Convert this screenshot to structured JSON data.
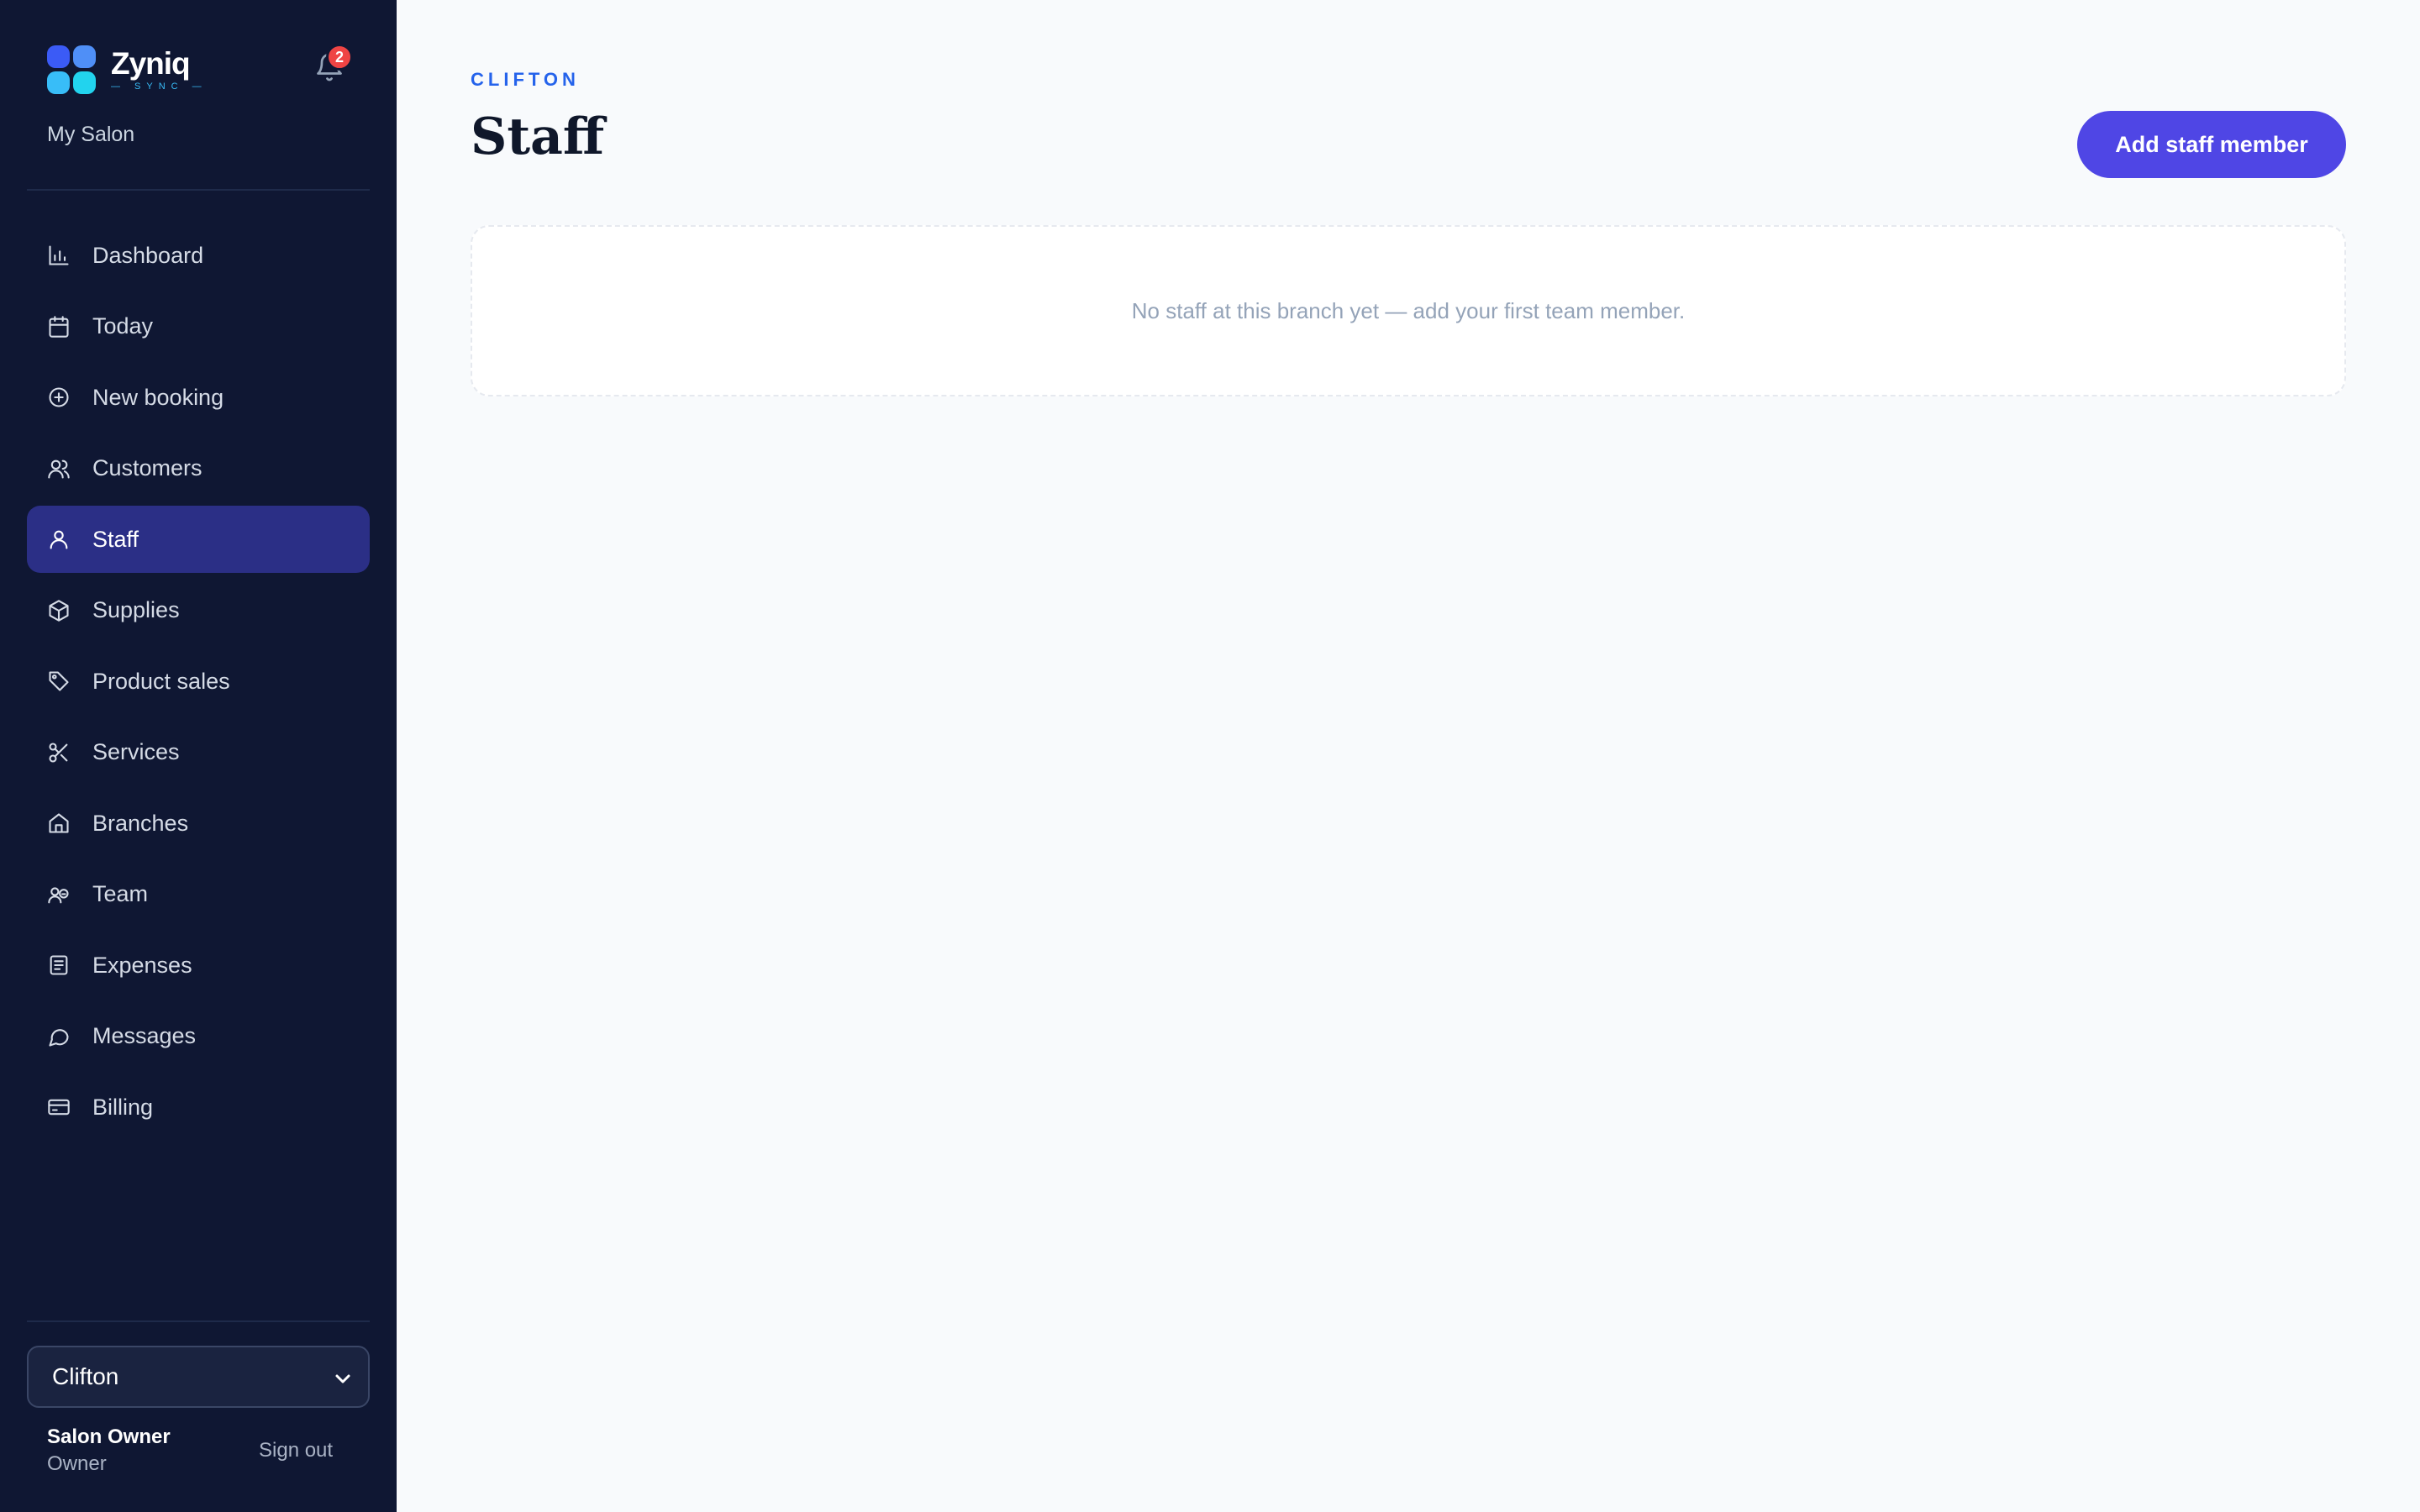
{
  "brand": {
    "name": "Zyniq",
    "sub": "— SYNC —",
    "salon": "My Salon",
    "notifications": "2",
    "colors": [
      "#3b5bf6",
      "#4f8ff7",
      "#38bdf8",
      "#22d3ee"
    ]
  },
  "nav": {
    "items": [
      {
        "label": "Dashboard",
        "icon": "bar-chart-icon"
      },
      {
        "label": "Today",
        "icon": "calendar-icon"
      },
      {
        "label": "New booking",
        "icon": "plus-circle-icon"
      },
      {
        "label": "Customers",
        "icon": "users-icon"
      },
      {
        "label": "Staff",
        "icon": "user-icon",
        "active": true
      },
      {
        "label": "Supplies",
        "icon": "box-icon"
      },
      {
        "label": "Product sales",
        "icon": "tag-icon"
      },
      {
        "label": "Services",
        "icon": "scissors-icon"
      },
      {
        "label": "Branches",
        "icon": "home-icon"
      },
      {
        "label": "Team",
        "icon": "team-icon"
      },
      {
        "label": "Expenses",
        "icon": "receipt-icon"
      },
      {
        "label": "Messages",
        "icon": "chat-icon"
      },
      {
        "label": "Billing",
        "icon": "credit-card-icon"
      }
    ]
  },
  "footer": {
    "branch": "Clifton",
    "user_name": "Salon Owner",
    "user_role": "Owner",
    "sign_out": "Sign out"
  },
  "main": {
    "branch_label": "CLIFTON",
    "title": "Staff",
    "add_button": "Add staff member",
    "empty_message": "No staff at this branch yet — add your first team member."
  },
  "colors": {
    "sidebar_bg": "#0f1733",
    "active_bg": "#2b2f86",
    "accent": "#4f46e5",
    "branch_label": "#2563eb",
    "badge": "#ef4444"
  }
}
